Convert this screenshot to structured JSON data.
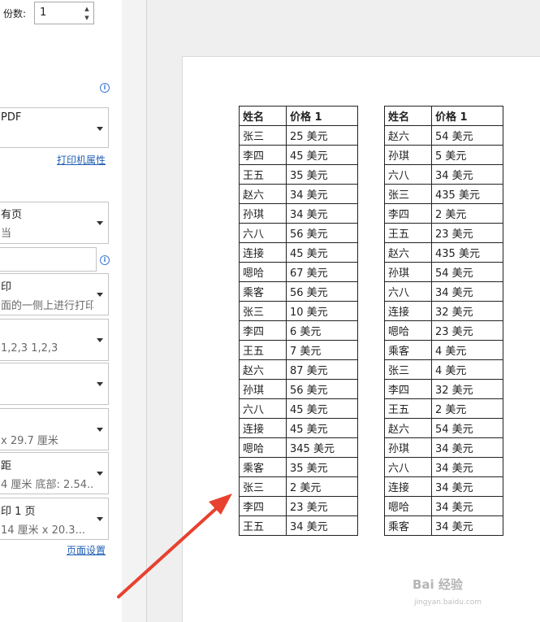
{
  "copies": {
    "label": "份数:",
    "value": "1"
  },
  "printer": {
    "name_partial": "PDF",
    "properties_link": "打印机属性"
  },
  "pages_setting": {
    "line1": "有页",
    "line2": "当"
  },
  "sides_setting": {
    "line1": "印",
    "line2": "面的一侧上进行打印"
  },
  "collate_setting": {
    "line2": "1,2,3    1,2,3"
  },
  "paper_size": {
    "line2": "x 29.7 厘米"
  },
  "margins": {
    "line1": "距",
    "line2": "4 厘米 底部: 2.54..."
  },
  "scaling": {
    "line1": "印 1 页",
    "line2": "14 厘米 x 20.3..."
  },
  "page_setup_link": "页面设置",
  "table_left": {
    "headers": [
      "姓名",
      "价格 1"
    ],
    "rows": [
      [
        "张三",
        "25 美元"
      ],
      [
        "李四",
        "45 美元"
      ],
      [
        "王五",
        "35 美元"
      ],
      [
        "赵六",
        "34 美元"
      ],
      [
        "孙琪",
        "34 美元"
      ],
      [
        "六八",
        "56 美元"
      ],
      [
        "连接",
        "45 美元"
      ],
      [
        "嗯哈",
        "67 美元"
      ],
      [
        "乘客",
        "56 美元"
      ],
      [
        "张三",
        "10 美元"
      ],
      [
        "李四",
        "6 美元"
      ],
      [
        "王五",
        "7 美元"
      ],
      [
        "赵六",
        "87 美元"
      ],
      [
        "孙琪",
        "56 美元"
      ],
      [
        "六八",
        "45 美元"
      ],
      [
        "连接",
        "45 美元"
      ],
      [
        "嗯哈",
        "345 美元"
      ],
      [
        "乘客",
        "35 美元"
      ],
      [
        "张三",
        "2 美元"
      ],
      [
        "李四",
        "23 美元"
      ],
      [
        "王五",
        "34 美元"
      ]
    ]
  },
  "table_right": {
    "headers": [
      "姓名",
      "价格 1"
    ],
    "rows": [
      [
        "赵六",
        "54 美元"
      ],
      [
        "孙琪",
        "5 美元"
      ],
      [
        "六八",
        "34 美元"
      ],
      [
        "张三",
        "435 美元"
      ],
      [
        "李四",
        "2 美元"
      ],
      [
        "王五",
        "23 美元"
      ],
      [
        "赵六",
        "435 美元"
      ],
      [
        "孙琪",
        "54 美元"
      ],
      [
        "六八",
        "34 美元"
      ],
      [
        "连接",
        "32 美元"
      ],
      [
        "嗯哈",
        "23 美元"
      ],
      [
        "乘客",
        "4 美元"
      ],
      [
        "张三",
        "4 美元"
      ],
      [
        "李四",
        "32 美元"
      ],
      [
        "王五",
        "2 美元"
      ],
      [
        "赵六",
        "54 美元"
      ],
      [
        "孙琪",
        "34 美元"
      ],
      [
        "六八",
        "34 美元"
      ],
      [
        "连接",
        "34 美元"
      ],
      [
        "嗯哈",
        "34 美元"
      ],
      [
        "乘客",
        "34 美元"
      ]
    ]
  },
  "watermark": {
    "text": "Bai 经验",
    "sub": "jingyan.baidu.com"
  },
  "colors": {
    "link": "#1f5fb4",
    "arrow": "#e8412f"
  }
}
